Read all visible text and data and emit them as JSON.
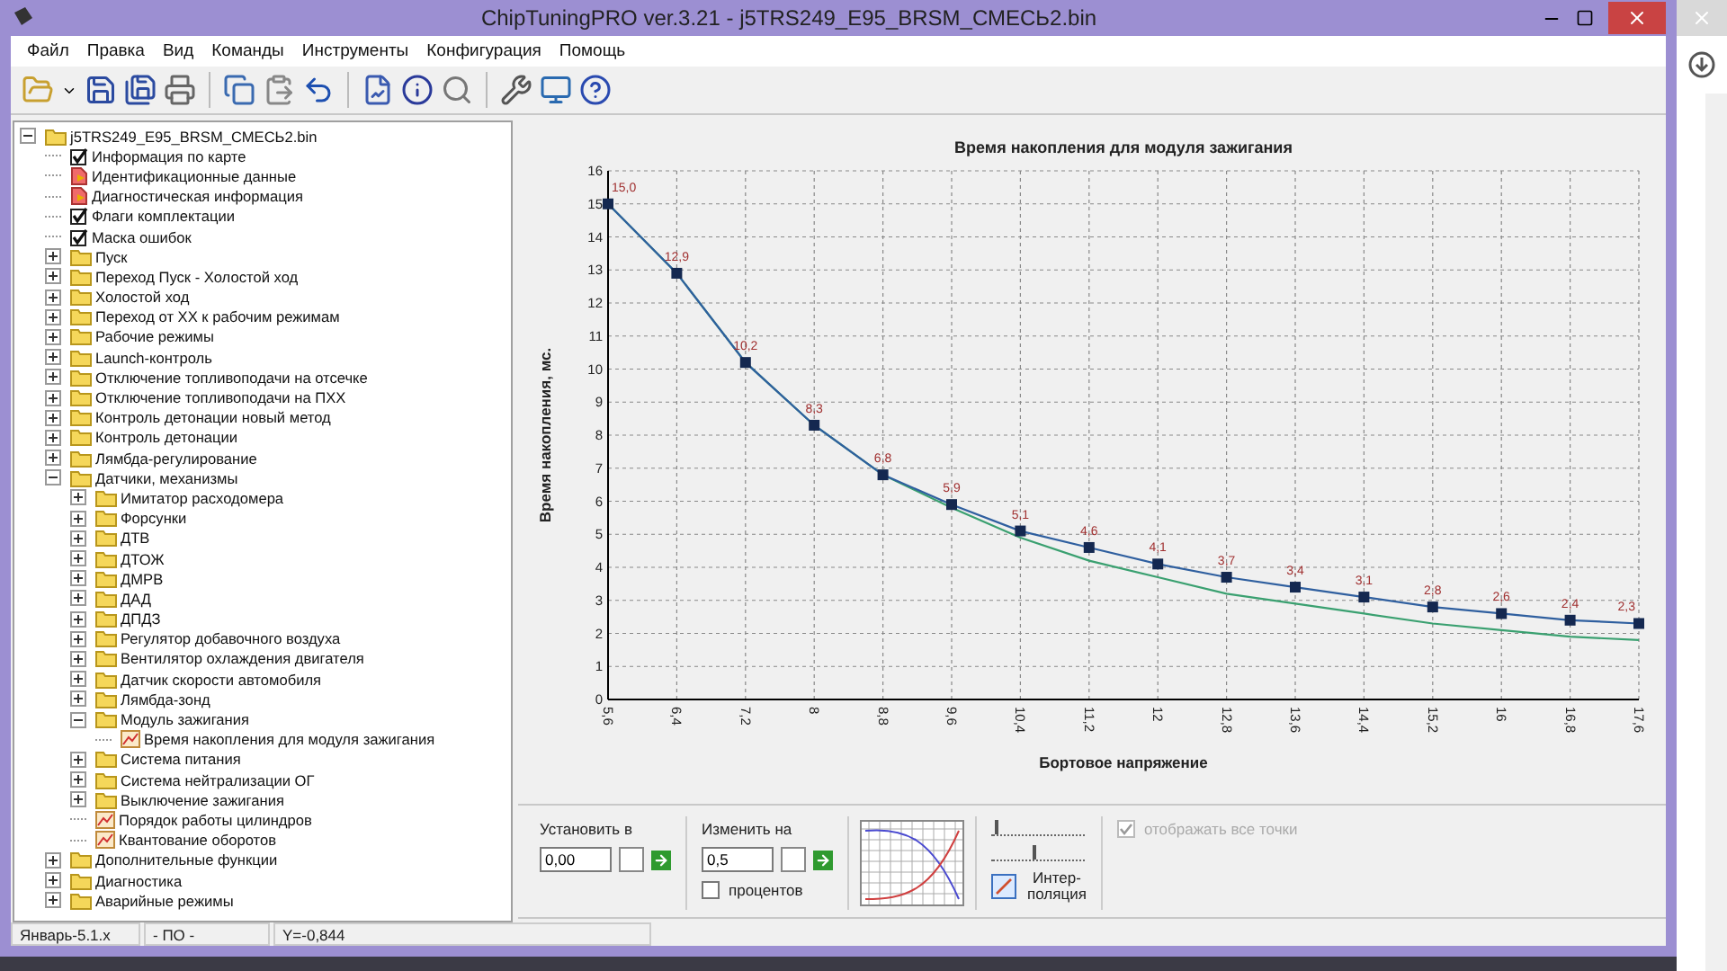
{
  "window": {
    "title": "ChipTuningPRO ver.3.21 - j5TRS249_E95_BRSM_СМЕСЬ2.bin"
  },
  "menu": [
    "Файл",
    "Правка",
    "Вид",
    "Команды",
    "Инструменты",
    "Конфигурация",
    "Помощь"
  ],
  "tree": [
    {
      "label": "j5TRS249_E95_BRSM_СМЕСЬ2.bin",
      "kind": "file",
      "expanded": true,
      "children": [
        {
          "label": "Информация по карте",
          "kind": "check"
        },
        {
          "label": "Идентификационные данные",
          "kind": "doc"
        },
        {
          "label": "Диагностическая информация",
          "kind": "doc"
        },
        {
          "label": "Флаги комплектации",
          "kind": "check"
        },
        {
          "label": "Маска ошибок",
          "kind": "check"
        },
        {
          "label": "Пуск",
          "kind": "folder",
          "expanded": false
        },
        {
          "label": "Переход Пуск - Холостой ход",
          "kind": "folder",
          "expanded": false
        },
        {
          "label": "Холостой ход",
          "kind": "folder",
          "expanded": false
        },
        {
          "label": "Переход от ХХ к рабочим режимам",
          "kind": "folder",
          "expanded": false
        },
        {
          "label": "Рабочие режимы",
          "kind": "folder",
          "expanded": false
        },
        {
          "label": "Launch-контроль",
          "kind": "folder",
          "expanded": false
        },
        {
          "label": "Отключение топливоподачи на отсечке",
          "kind": "folder",
          "expanded": false
        },
        {
          "label": "Отключение топливоподачи на ПХХ",
          "kind": "folder",
          "expanded": false
        },
        {
          "label": "Контроль детонации новый метод",
          "kind": "folder",
          "expanded": false
        },
        {
          "label": "Контроль детонации",
          "kind": "folder",
          "expanded": false
        },
        {
          "label": "Лямбда-регулирование",
          "kind": "folder",
          "expanded": false
        },
        {
          "label": "Датчики, механизмы",
          "kind": "folder",
          "expanded": true,
          "children": [
            {
              "label": "Имитатор расходомера",
              "kind": "folder",
              "expanded": false
            },
            {
              "label": "Форсунки",
              "kind": "folder",
              "expanded": false
            },
            {
              "label": "ДТВ",
              "kind": "folder",
              "expanded": false
            },
            {
              "label": "ДТОЖ",
              "kind": "folder",
              "expanded": false
            },
            {
              "label": "ДМРВ",
              "kind": "folder",
              "expanded": false
            },
            {
              "label": "ДАД",
              "kind": "folder",
              "expanded": false
            },
            {
              "label": "ДПДЗ",
              "kind": "folder",
              "expanded": false
            },
            {
              "label": "Регулятор добавочного воздуха",
              "kind": "folder",
              "expanded": false
            },
            {
              "label": "Вентилятор охлаждения двигателя",
              "kind": "folder",
              "expanded": false
            },
            {
              "label": "Датчик скорости автомобиля",
              "kind": "folder",
              "expanded": false
            },
            {
              "label": "Лямбда-зонд",
              "kind": "folder",
              "expanded": false
            },
            {
              "label": "Модуль зажигания",
              "kind": "folder",
              "expanded": true,
              "children": [
                {
                  "label": "Время накопления для модуля зажигания",
                  "kind": "table"
                }
              ]
            },
            {
              "label": "Система питания",
              "kind": "folder",
              "expanded": false
            },
            {
              "label": "Система нейтрализации ОГ",
              "kind": "folder",
              "expanded": false
            },
            {
              "label": "Выключение зажигания",
              "kind": "folder",
              "expanded": false
            },
            {
              "label": "Порядок работы цилиндров",
              "kind": "table"
            },
            {
              "label": "Квантование оборотов",
              "kind": "table"
            }
          ]
        },
        {
          "label": "Дополнительные функции",
          "kind": "folder",
          "expanded": false
        },
        {
          "label": "Диагностика",
          "kind": "folder",
          "expanded": false
        },
        {
          "label": "Аварийные режимы",
          "kind": "folder",
          "expanded": false
        }
      ]
    }
  ],
  "chart": {
    "chart_data": {
      "type": "line",
      "title": "Время накопления для модуля зажигания",
      "xlabel": "Бортовое напряжение",
      "ylabel": "Время накопления, мс.",
      "x": [
        5.6,
        6.4,
        7.2,
        8,
        8.8,
        9.6,
        10.4,
        11.2,
        12,
        12.8,
        13.6,
        14.4,
        15.2,
        16,
        16.8,
        17.6
      ],
      "series": [
        {
          "color": "#2f5f9f",
          "marker": "square",
          "values": [
            15.0,
            12.9,
            10.2,
            8.3,
            6.8,
            5.9,
            5.1,
            4.6,
            4.1,
            3.7,
            3.4,
            3.1,
            2.8,
            2.6,
            2.4,
            2.3
          ]
        },
        {
          "color": "#3aa070",
          "values": [
            15.0,
            12.9,
            10.2,
            8.3,
            6.8,
            5.8,
            4.9,
            4.2,
            3.7,
            3.2,
            2.9,
            2.6,
            2.3,
            2.1,
            1.9,
            1.8
          ]
        }
      ],
      "xlim": [
        5.6,
        17.6
      ],
      "ylim": [
        0,
        16
      ],
      "grid": true,
      "xticks": [
        {
          "value": 5.6,
          "label": "5,6"
        },
        {
          "value": 6.4,
          "label": "6,4"
        },
        {
          "value": 7.2,
          "label": "7,2"
        },
        {
          "value": 8,
          "label": "8"
        },
        {
          "value": 8.8,
          "label": "8,8"
        },
        {
          "value": 9.6,
          "label": "9,6"
        },
        {
          "value": 10.4,
          "label": "10,4"
        },
        {
          "value": 11.2,
          "label": "11,2"
        },
        {
          "value": 12,
          "label": "12"
        },
        {
          "value": 12.8,
          "label": "12,8"
        },
        {
          "value": 13.6,
          "label": "13,6"
        },
        {
          "value": 14.4,
          "label": "14,4"
        },
        {
          "value": 15.2,
          "label": "15,2"
        },
        {
          "value": 16,
          "label": "16"
        },
        {
          "value": 16.8,
          "label": "16,8"
        },
        {
          "value": 17.6,
          "label": "17,6"
        }
      ],
      "yticks": [
        0,
        1,
        2,
        3,
        4,
        5,
        6,
        7,
        8,
        9,
        10,
        11,
        12,
        13,
        14,
        15,
        16
      ],
      "value_labels": [
        "15,0",
        "12,9",
        "10,2",
        "8,3",
        "6,8",
        "5,9",
        "5,1",
        "4,6",
        "4,1",
        "3,7",
        "3,4",
        "3,1",
        "2,8",
        "2,6",
        "2,4",
        "2,3"
      ]
    }
  },
  "controls": {
    "set_to": {
      "label": "Установить в",
      "value": "0,00"
    },
    "change_by": {
      "label": "Изменить на",
      "value": "0,5",
      "percent": {
        "label": "процентов",
        "checked": false
      }
    },
    "sliders": [
      {
        "level": 0.03
      },
      {
        "level": 0.45
      }
    ],
    "interpolation": {
      "label": "Интер-\nполяция"
    },
    "show_all_points": {
      "label": "отображать все точки",
      "checked": true,
      "disabled": true
    }
  },
  "status_bar": [
    "Январь-5.1.x",
    "- ПО -",
    "Y=-0,844"
  ]
}
